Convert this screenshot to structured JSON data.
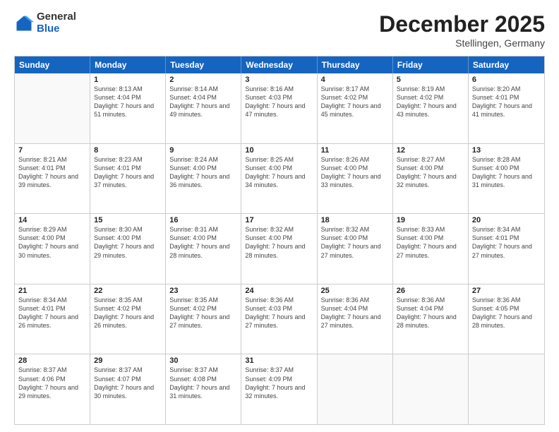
{
  "logo": {
    "general": "General",
    "blue": "Blue"
  },
  "header": {
    "month": "December 2025",
    "location": "Stellingen, Germany"
  },
  "days": [
    "Sunday",
    "Monday",
    "Tuesday",
    "Wednesday",
    "Thursday",
    "Friday",
    "Saturday"
  ],
  "rows": [
    [
      {
        "day": "",
        "empty": true
      },
      {
        "day": "1",
        "sunrise": "Sunrise: 8:13 AM",
        "sunset": "Sunset: 4:04 PM",
        "daylight": "Daylight: 7 hours and 51 minutes."
      },
      {
        "day": "2",
        "sunrise": "Sunrise: 8:14 AM",
        "sunset": "Sunset: 4:04 PM",
        "daylight": "Daylight: 7 hours and 49 minutes."
      },
      {
        "day": "3",
        "sunrise": "Sunrise: 8:16 AM",
        "sunset": "Sunset: 4:03 PM",
        "daylight": "Daylight: 7 hours and 47 minutes."
      },
      {
        "day": "4",
        "sunrise": "Sunrise: 8:17 AM",
        "sunset": "Sunset: 4:02 PM",
        "daylight": "Daylight: 7 hours and 45 minutes."
      },
      {
        "day": "5",
        "sunrise": "Sunrise: 8:19 AM",
        "sunset": "Sunset: 4:02 PM",
        "daylight": "Daylight: 7 hours and 43 minutes."
      },
      {
        "day": "6",
        "sunrise": "Sunrise: 8:20 AM",
        "sunset": "Sunset: 4:01 PM",
        "daylight": "Daylight: 7 hours and 41 minutes."
      }
    ],
    [
      {
        "day": "7",
        "sunrise": "Sunrise: 8:21 AM",
        "sunset": "Sunset: 4:01 PM",
        "daylight": "Daylight: 7 hours and 39 minutes."
      },
      {
        "day": "8",
        "sunrise": "Sunrise: 8:23 AM",
        "sunset": "Sunset: 4:01 PM",
        "daylight": "Daylight: 7 hours and 37 minutes."
      },
      {
        "day": "9",
        "sunrise": "Sunrise: 8:24 AM",
        "sunset": "Sunset: 4:00 PM",
        "daylight": "Daylight: 7 hours and 36 minutes."
      },
      {
        "day": "10",
        "sunrise": "Sunrise: 8:25 AM",
        "sunset": "Sunset: 4:00 PM",
        "daylight": "Daylight: 7 hours and 34 minutes."
      },
      {
        "day": "11",
        "sunrise": "Sunrise: 8:26 AM",
        "sunset": "Sunset: 4:00 PM",
        "daylight": "Daylight: 7 hours and 33 minutes."
      },
      {
        "day": "12",
        "sunrise": "Sunrise: 8:27 AM",
        "sunset": "Sunset: 4:00 PM",
        "daylight": "Daylight: 7 hours and 32 minutes."
      },
      {
        "day": "13",
        "sunrise": "Sunrise: 8:28 AM",
        "sunset": "Sunset: 4:00 PM",
        "daylight": "Daylight: 7 hours and 31 minutes."
      }
    ],
    [
      {
        "day": "14",
        "sunrise": "Sunrise: 8:29 AM",
        "sunset": "Sunset: 4:00 PM",
        "daylight": "Daylight: 7 hours and 30 minutes."
      },
      {
        "day": "15",
        "sunrise": "Sunrise: 8:30 AM",
        "sunset": "Sunset: 4:00 PM",
        "daylight": "Daylight: 7 hours and 29 minutes."
      },
      {
        "day": "16",
        "sunrise": "Sunrise: 8:31 AM",
        "sunset": "Sunset: 4:00 PM",
        "daylight": "Daylight: 7 hours and 28 minutes."
      },
      {
        "day": "17",
        "sunrise": "Sunrise: 8:32 AM",
        "sunset": "Sunset: 4:00 PM",
        "daylight": "Daylight: 7 hours and 28 minutes."
      },
      {
        "day": "18",
        "sunrise": "Sunrise: 8:32 AM",
        "sunset": "Sunset: 4:00 PM",
        "daylight": "Daylight: 7 hours and 27 minutes."
      },
      {
        "day": "19",
        "sunrise": "Sunrise: 8:33 AM",
        "sunset": "Sunset: 4:00 PM",
        "daylight": "Daylight: 7 hours and 27 minutes."
      },
      {
        "day": "20",
        "sunrise": "Sunrise: 8:34 AM",
        "sunset": "Sunset: 4:01 PM",
        "daylight": "Daylight: 7 hours and 27 minutes."
      }
    ],
    [
      {
        "day": "21",
        "sunrise": "Sunrise: 8:34 AM",
        "sunset": "Sunset: 4:01 PM",
        "daylight": "Daylight: 7 hours and 26 minutes."
      },
      {
        "day": "22",
        "sunrise": "Sunrise: 8:35 AM",
        "sunset": "Sunset: 4:02 PM",
        "daylight": "Daylight: 7 hours and 26 minutes."
      },
      {
        "day": "23",
        "sunrise": "Sunrise: 8:35 AM",
        "sunset": "Sunset: 4:02 PM",
        "daylight": "Daylight: 7 hours and 27 minutes."
      },
      {
        "day": "24",
        "sunrise": "Sunrise: 8:36 AM",
        "sunset": "Sunset: 4:03 PM",
        "daylight": "Daylight: 7 hours and 27 minutes."
      },
      {
        "day": "25",
        "sunrise": "Sunrise: 8:36 AM",
        "sunset": "Sunset: 4:04 PM",
        "daylight": "Daylight: 7 hours and 27 minutes."
      },
      {
        "day": "26",
        "sunrise": "Sunrise: 8:36 AM",
        "sunset": "Sunset: 4:04 PM",
        "daylight": "Daylight: 7 hours and 28 minutes."
      },
      {
        "day": "27",
        "sunrise": "Sunrise: 8:36 AM",
        "sunset": "Sunset: 4:05 PM",
        "daylight": "Daylight: 7 hours and 28 minutes."
      }
    ],
    [
      {
        "day": "28",
        "sunrise": "Sunrise: 8:37 AM",
        "sunset": "Sunset: 4:06 PM",
        "daylight": "Daylight: 7 hours and 29 minutes."
      },
      {
        "day": "29",
        "sunrise": "Sunrise: 8:37 AM",
        "sunset": "Sunset: 4:07 PM",
        "daylight": "Daylight: 7 hours and 30 minutes."
      },
      {
        "day": "30",
        "sunrise": "Sunrise: 8:37 AM",
        "sunset": "Sunset: 4:08 PM",
        "daylight": "Daylight: 7 hours and 31 minutes."
      },
      {
        "day": "31",
        "sunrise": "Sunrise: 8:37 AM",
        "sunset": "Sunset: 4:09 PM",
        "daylight": "Daylight: 7 hours and 32 minutes."
      },
      {
        "day": "",
        "empty": true
      },
      {
        "day": "",
        "empty": true
      },
      {
        "day": "",
        "empty": true
      }
    ]
  ]
}
